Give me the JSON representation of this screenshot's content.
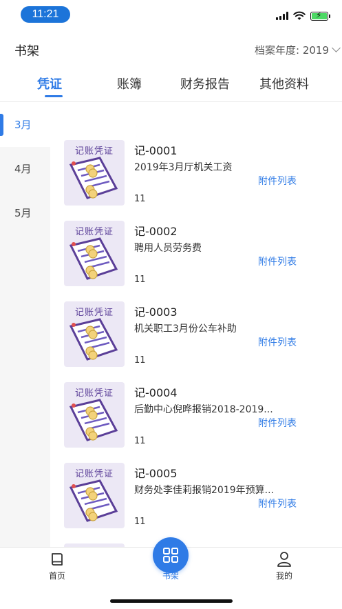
{
  "status": {
    "time": "11:21"
  },
  "header": {
    "title": "书架",
    "year_label": "档案年度: 2019"
  },
  "tabs": [
    {
      "label": "凭证",
      "active": true
    },
    {
      "label": "账簿",
      "active": false
    },
    {
      "label": "财务报告",
      "active": false
    },
    {
      "label": "其他资料",
      "active": false
    }
  ],
  "months": [
    {
      "label": "3月",
      "active": true
    },
    {
      "label": "4月",
      "active": false
    },
    {
      "label": "5月",
      "active": false
    }
  ],
  "thumb_label": "记账凭证",
  "vouchers": [
    {
      "code": "记-0001",
      "desc": "2019年3月厅机关工资",
      "attach": "附件列表",
      "count": "11"
    },
    {
      "code": "记-0002",
      "desc": "聘用人员劳务费",
      "attach": "附件列表",
      "count": "11"
    },
    {
      "code": "记-0003",
      "desc": "机关职工3月份公车补助",
      "attach": "附件列表",
      "count": "11"
    },
    {
      "code": "记-0004",
      "desc": "后勤中心倪晔报销2018-2019...",
      "attach": "附件列表",
      "count": "11"
    },
    {
      "code": "记-0005",
      "desc": "财务处李佳莉报销2019年预算...",
      "attach": "附件列表",
      "count": "11"
    }
  ],
  "bottom_nav": [
    {
      "label": "首页",
      "icon": "book-icon",
      "active": false
    },
    {
      "label": "书架",
      "icon": "grid-icon",
      "active": true
    },
    {
      "label": "我的",
      "icon": "person-icon",
      "active": false
    }
  ],
  "colors": {
    "accent": "#2f7be6",
    "time_pill": "#1c74d9",
    "thumb_bg": "#ece8f5",
    "thumb_ink": "#5b3f98"
  }
}
